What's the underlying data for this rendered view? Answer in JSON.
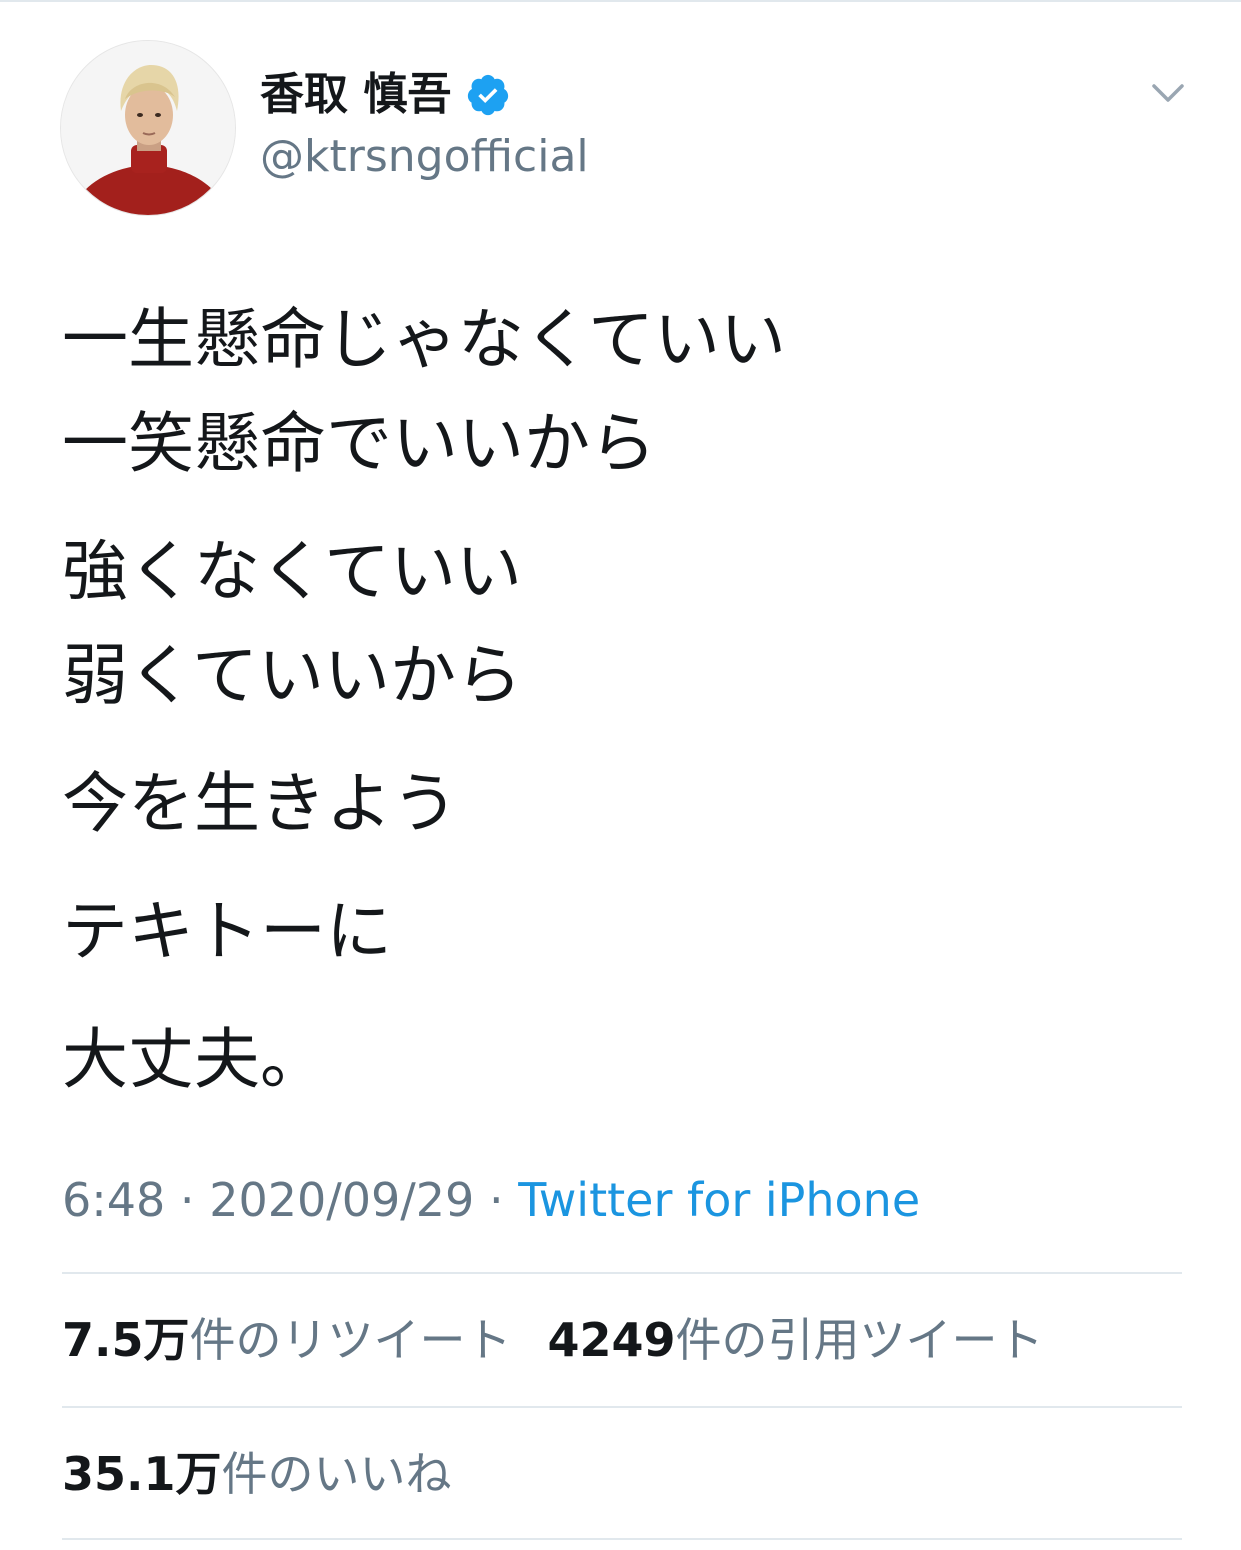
{
  "user": {
    "display_name": "香取 慎吾",
    "handle": "@ktrsngofficial",
    "verified_icon": "verified-badge-icon",
    "avatar_icon": "profile-avatar"
  },
  "header": {
    "menu_icon": "chevron-down-icon"
  },
  "tweet": {
    "paragraphs": [
      [
        "一生懸命じゃなくていい",
        "一笑懸命でいいから"
      ],
      [
        "強くなくていい",
        "弱くていいから"
      ],
      [
        "今を生きよう"
      ],
      [
        "テキトーに"
      ],
      [
        "大丈夫。"
      ]
    ]
  },
  "meta": {
    "time": "6:48",
    "sep1": " · ",
    "date": "2020/09/29",
    "sep2": " · ",
    "source": "Twitter for iPhone"
  },
  "stats": {
    "retweets_count": "7.5万",
    "retweets_label": "件のリツイート",
    "quotes_count": "4249",
    "quotes_label": "件の引用ツイート",
    "likes_count": "35.1万",
    "likes_label": "件のいいね"
  },
  "colors": {
    "text": "#14171a",
    "secondary": "#657786",
    "link": "#1b95e0",
    "verified": "#1da1f2",
    "divider": "#e1e8ed"
  }
}
